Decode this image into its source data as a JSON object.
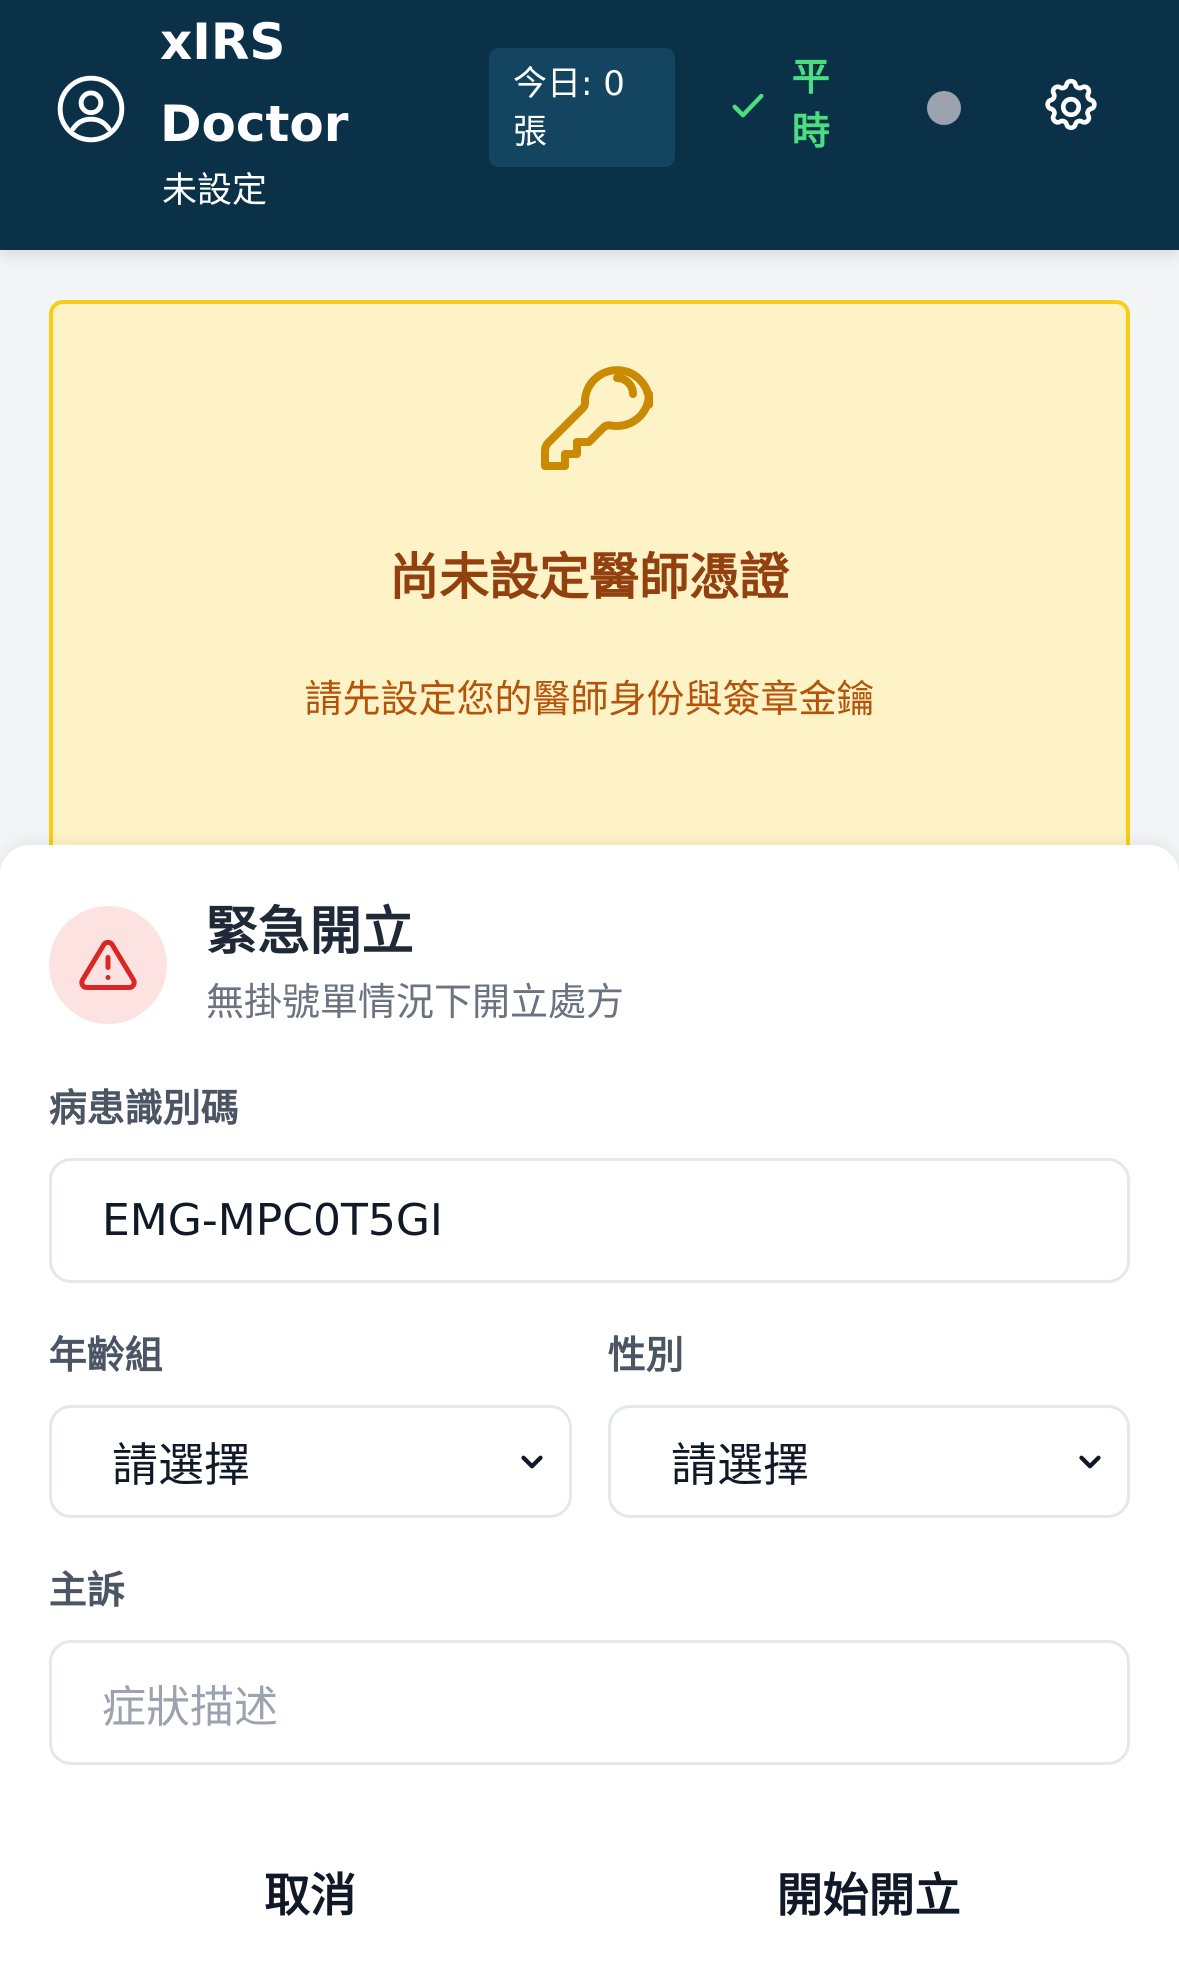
{
  "header": {
    "brand_line1": "xIRS",
    "brand_line2": "Doctor",
    "subtitle": "未設定",
    "today_count": "今日: 0 張",
    "mode": "平時",
    "icons": {
      "avatar": "user-circle-icon",
      "check": "check-icon",
      "status": "status-dot",
      "settings": "gear-icon"
    },
    "colors": {
      "background": "#0b3149",
      "badge": "#134560",
      "mode": "#4ade80",
      "status_dot": "#9ca3af"
    }
  },
  "warning": {
    "icon": "key-icon",
    "title": "尚未設定醫師憑證",
    "subtitle": "請先設定您的醫師身份與簽章金鑰",
    "colors": {
      "background": "#fef3c7",
      "border": "#facc15",
      "title": "#92400e",
      "subtitle": "#b45309",
      "icon": "#ca8a04"
    }
  },
  "sheet": {
    "icon": "alert-triangle-icon",
    "title": "緊急開立",
    "subtitle": "無掛號單情況下開立處方",
    "patient_id": {
      "label": "病患識別碼",
      "value": "EMG-MPC0T5GI"
    },
    "age_group": {
      "label": "年齡組",
      "selected": "請選擇"
    },
    "gender": {
      "label": "性別",
      "selected": "請選擇"
    },
    "complaint": {
      "label": "主訴",
      "placeholder": "症狀描述"
    },
    "cancel_label": "取消",
    "start_label": "開始開立",
    "colors": {
      "alert_bg": "#fde2e2",
      "alert_icon": "#dc2626"
    }
  }
}
